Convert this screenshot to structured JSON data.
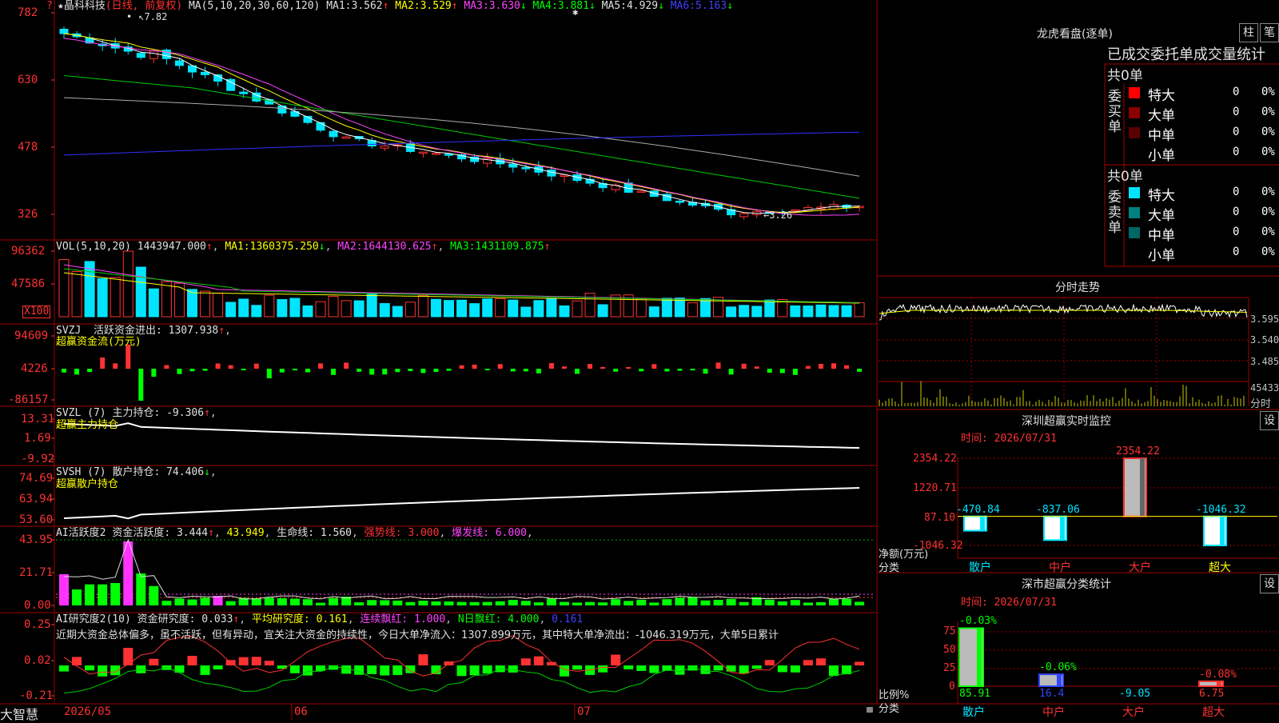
{
  "stock": {
    "name": "晶科科技",
    "period_note": "(日线, 前复权)"
  },
  "main": {
    "indicator": "MA(5,10,20,30,60,120)",
    "ma": [
      {
        "label": "MA1:",
        "value": "3.562",
        "arrow": "↑"
      },
      {
        "label": "MA2:",
        "value": "3.529",
        "arrow": "↑"
      },
      {
        "label": "MA3:",
        "value": "3.630",
        "arrow": "↓"
      },
      {
        "label": "MA4:",
        "value": "3.881",
        "arrow": "↓"
      },
      {
        "label": "MA5:",
        "value": "4.929",
        "arrow": "↓"
      },
      {
        "label": "MA6:",
        "value": "5.163",
        "arrow": "↓"
      }
    ],
    "yaxis": [
      "782",
      "630",
      "478",
      "326"
    ],
    "high_label": "7.82",
    "low_label": "3.26"
  },
  "vol": {
    "indicator": "VOL(5,10,20)",
    "value": "1443947.000",
    "ma": [
      {
        "label": "MA1:",
        "value": "1360375.250",
        "arrow": "↓"
      },
      {
        "label": "MA2:",
        "value": "1644130.625",
        "arrow": "↑"
      },
      {
        "label": "MA3:",
        "value": "1431109.875",
        "arrow": "↑"
      }
    ],
    "yaxis": [
      "96362",
      "47586"
    ],
    "unit": "X100"
  },
  "svzj": {
    "indicator": "SVZJ",
    "name": "活跃资金进出:",
    "value": "1307.938",
    "title": "超赢资金流(万元)",
    "yaxis": [
      "94609",
      "4226",
      "-86157"
    ]
  },
  "svzl": {
    "indicator": "SVZL (7)",
    "name": "主力持仓:",
    "value": "-9.306",
    "title": "超赢主力持仓",
    "yaxis": [
      "13.31",
      "1.69",
      "-9.92"
    ]
  },
  "svsh": {
    "indicator": "SVSH (7)",
    "name": "散户持仓:",
    "value": "74.406",
    "title": "超赢散户持仓",
    "yaxis": [
      "74.69",
      "63.94",
      "53.60"
    ]
  },
  "ai1": {
    "indicator": "AI活跃度2",
    "l1": "资金活跃度:",
    "v1": "3.444",
    "v2": "43.949",
    "l3": "生命线:",
    "v3": "1.560",
    "l4": "强势线:",
    "v4": "3.000",
    "l5": "爆发线:",
    "v5": "6.000",
    "yaxis": [
      "43.95",
      "21.71",
      "0.00"
    ]
  },
  "ai2": {
    "indicator": "AI研究度2(10)",
    "l1": "资金研究度:",
    "v1": "0.033",
    "l2": "平均研究度:",
    "v2": "0.161",
    "l3": "连续飘红:",
    "v3": "1.000",
    "l4": "N日飘红:",
    "v4": "4.000",
    "v5": "0.161",
    "comment": "近期大资金总体偏多，虽不活跃，但有异动，宜关注大资金的持续性，今日大单净流入：1307.899万元，其中特大单净流出：-1046.319万元，大单5日累计",
    "yaxis": [
      "0.25",
      "0.02",
      "-0.21"
    ]
  },
  "xaxis": {
    "labels": [
      "2026/05",
      "06",
      "07"
    ],
    "brand": "大智慧"
  },
  "lhb": {
    "title": "龙虎看盘(逐单)",
    "tab1": "柱",
    "tab2": "笔",
    "stat_title": "已成交委托单成交量统计",
    "buy": {
      "side": "委买单",
      "total": "共0单",
      "rows": [
        {
          "name": "特大",
          "count": "0",
          "pct": "0%",
          "color": "#ff0000"
        },
        {
          "name": "大单",
          "count": "0",
          "pct": "0%",
          "color": "#8b0000"
        },
        {
          "name": "中单",
          "count": "0",
          "pct": "0%",
          "color": "#5a0000"
        },
        {
          "name": "小单",
          "count": "0",
          "pct": "0%",
          "color": ""
        }
      ]
    },
    "sell": {
      "side": "委卖单",
      "total": "共0单",
      "rows": [
        {
          "name": "特大",
          "count": "0",
          "pct": "0%",
          "color": "#00e5ff"
        },
        {
          "name": "大单",
          "count": "0",
          "pct": "0%",
          "color": "#008080"
        },
        {
          "name": "中单",
          "count": "0",
          "pct": "0%",
          "color": "#006666"
        },
        {
          "name": "小单",
          "count": "0",
          "pct": "0%",
          "color": ""
        }
      ]
    }
  },
  "intraday": {
    "title": "分时走势",
    "yaxis": [
      "3.595",
      "3.540",
      "3.485"
    ],
    "vol_max": "45433",
    "unit": "分时"
  },
  "sz_monitor": {
    "title": "深圳超赢实时监控",
    "set": "设",
    "time": "时间: 2026/07/31",
    "yaxis": [
      "2354.22",
      "1220.71",
      "87.10",
      "-1046.32"
    ],
    "ylabel": "净额(万元)",
    "xlabel": "分类"
  },
  "sz_class": {
    "title": "深市超赢分类统计",
    "set": "设",
    "time": "时间: 2026/07/31",
    "yaxis": [
      "75",
      "50",
      "25",
      "0"
    ],
    "ylabel": "比例%",
    "xlabel": "分类"
  },
  "chart_data": [
    {
      "type": "bar",
      "title": "深圳超赢实时监控",
      "categories": [
        "散户",
        "中户",
        "大户",
        "超大"
      ],
      "values": [
        -470.84,
        -837.06,
        2354.22,
        -1046.32
      ],
      "ylabel": "净额(万元)",
      "xlabel": "分类",
      "ylim": [
        -1046.32,
        2354.22
      ]
    },
    {
      "type": "bar",
      "title": "深市超赢分类统计",
      "categories": [
        "散户",
        "中户",
        "大户",
        "超大"
      ],
      "values": [
        85.91,
        16.4,
        -9.05,
        6.75
      ],
      "ratios": [
        "-0.03%",
        "-0.06%",
        "",
        "-0.08%"
      ],
      "ylabel": "比例%",
      "xlabel": "分类",
      "ylim": [
        0,
        75
      ]
    }
  ]
}
